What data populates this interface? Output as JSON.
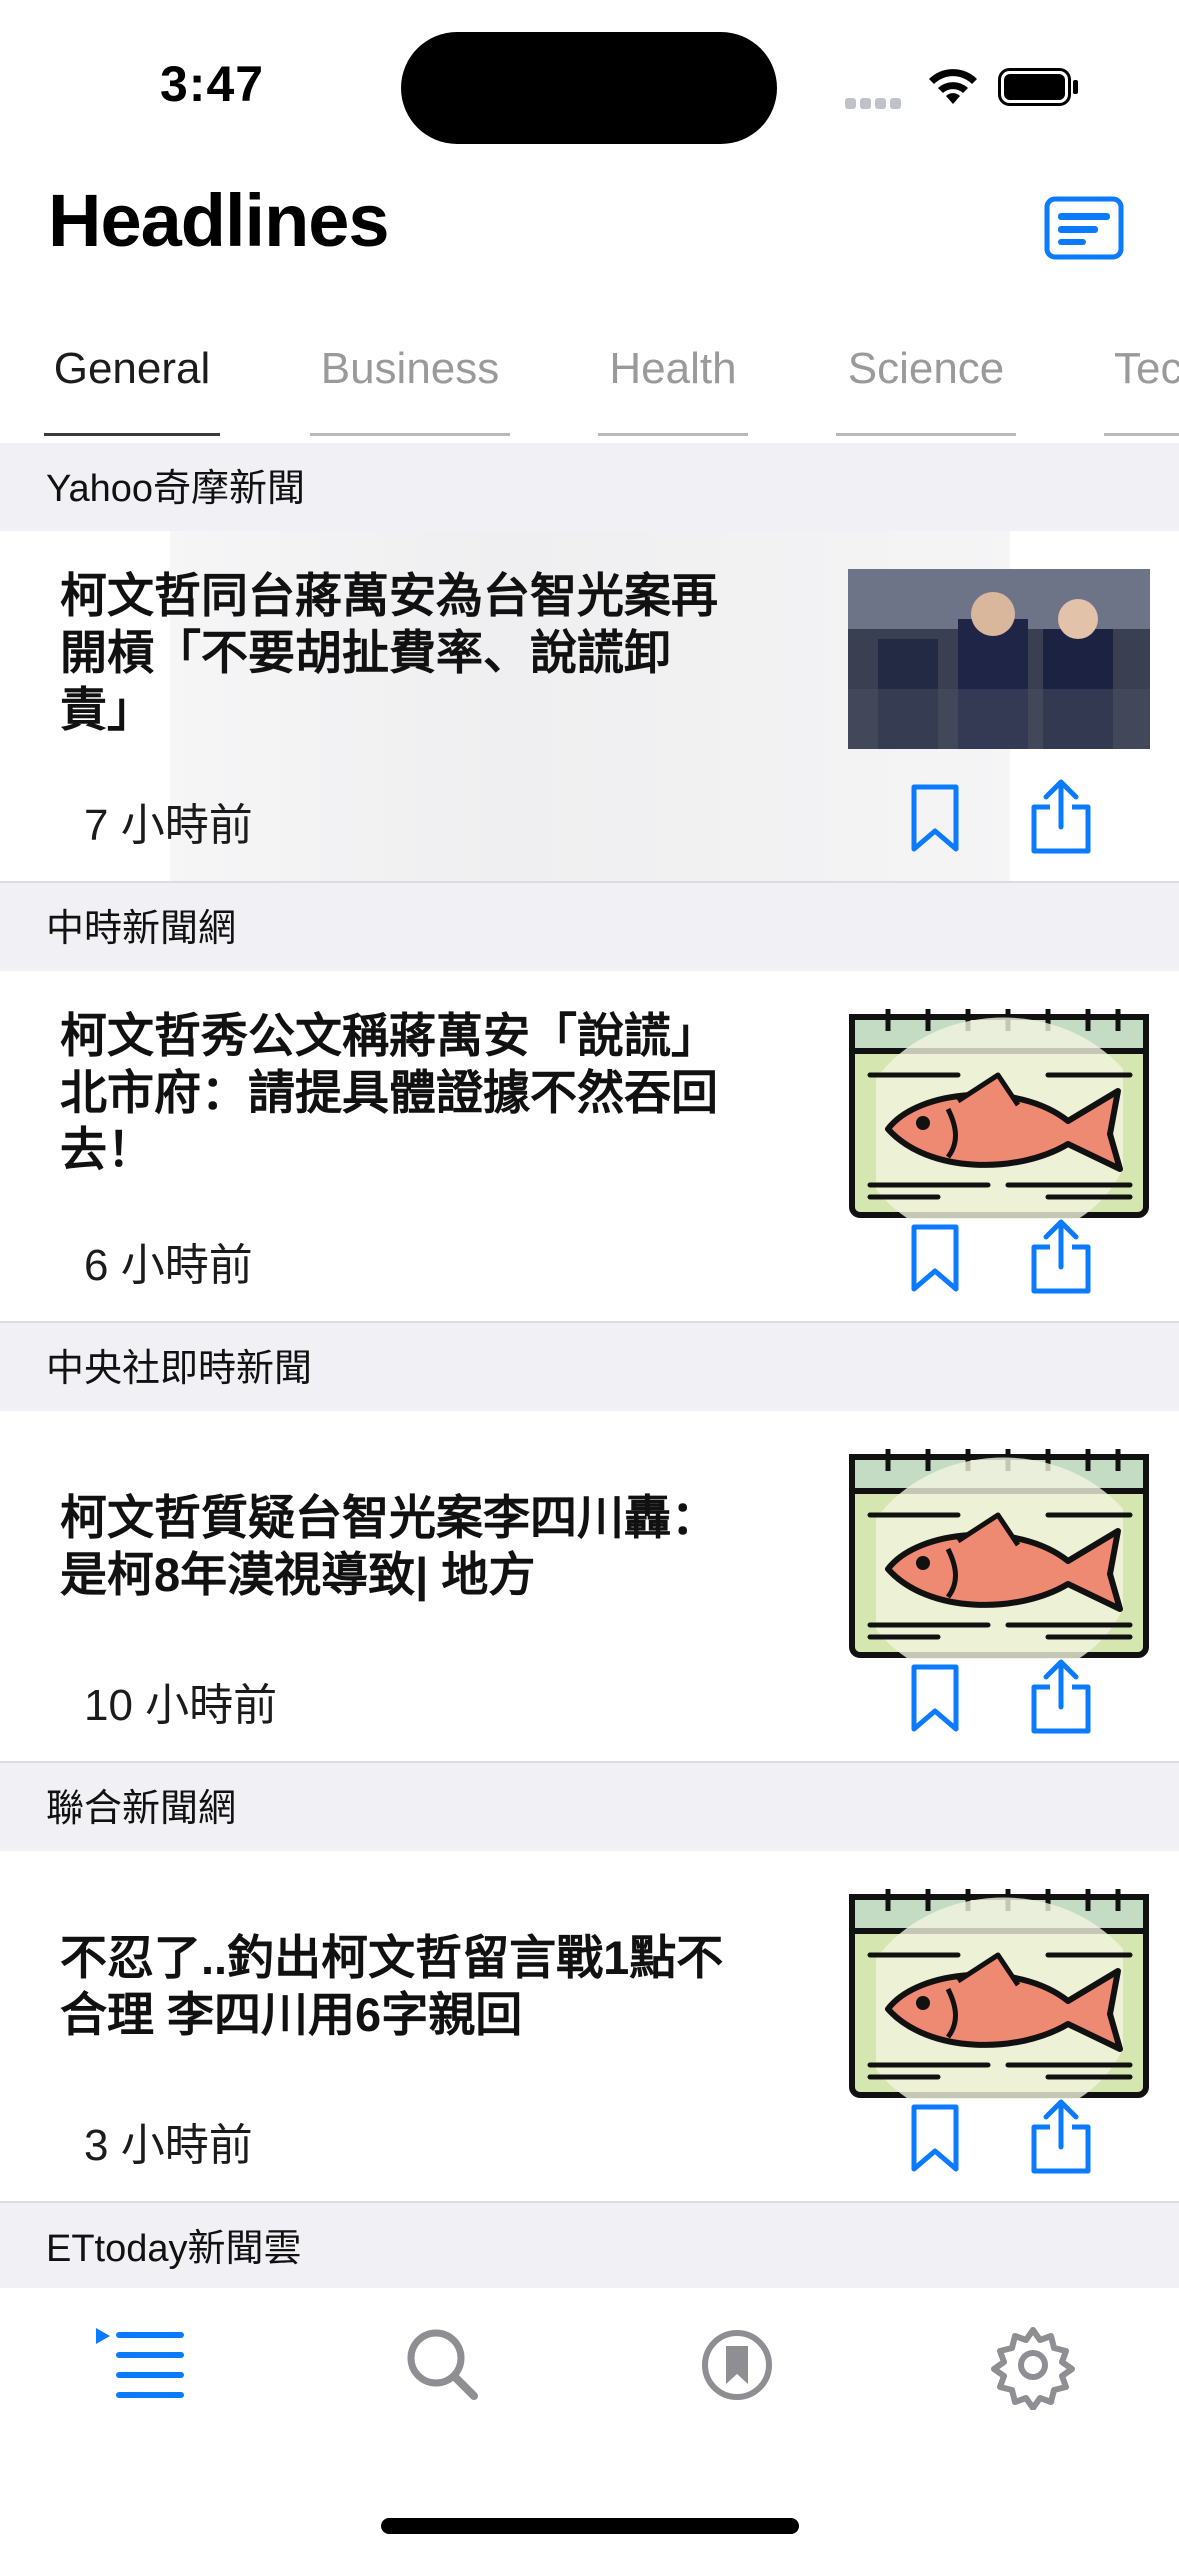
{
  "status_bar": {
    "time": "3:47"
  },
  "header": {
    "title": "Headlines",
    "layout_button_icon": "news-layout-icon"
  },
  "tabs": [
    {
      "label": "General",
      "active": true
    },
    {
      "label": "Business",
      "active": false
    },
    {
      "label": "Health",
      "active": false
    },
    {
      "label": "Science",
      "active": false
    },
    {
      "label": "Tec",
      "active": false
    }
  ],
  "articles": [
    {
      "source": "Yahoo奇摩新聞",
      "title": "柯文哲同台蔣萬安為台智光案再開槓「不要胡扯費率、說謊卸責」",
      "time": "7 小時前",
      "thumbnail": "press-photo"
    },
    {
      "source": "中時新聞網",
      "title": "柯文哲秀公文稱蔣萬安「說謊」 北市府：請提具體證據不然吞回去！",
      "time": "6 小時前",
      "thumbnail": "fish-placeholder-icon"
    },
    {
      "source": "中央社即時新聞",
      "title": "柯文哲質疑台智光案李四川轟：是柯8年漠視導致| 地方",
      "time": "10 小時前",
      "thumbnail": "fish-placeholder-icon"
    },
    {
      "source": "聯合新聞網",
      "title": "不忍了..釣出柯文哲留言戰1點不合理 李四川用6字親回",
      "time": "3 小時前",
      "thumbnail": "fish-placeholder-icon"
    }
  ],
  "next_source": "ETtoday新聞雲",
  "tab_bar": [
    {
      "icon": "headlines-list-icon",
      "active": true
    },
    {
      "icon": "search-icon",
      "active": false
    },
    {
      "icon": "bookmark-circle-icon",
      "active": false
    },
    {
      "icon": "gear-icon",
      "active": false
    }
  ],
  "colors": {
    "accent": "#0a7aff",
    "inactive": "#8e8e93",
    "section_bg": "#f1f1f5"
  }
}
